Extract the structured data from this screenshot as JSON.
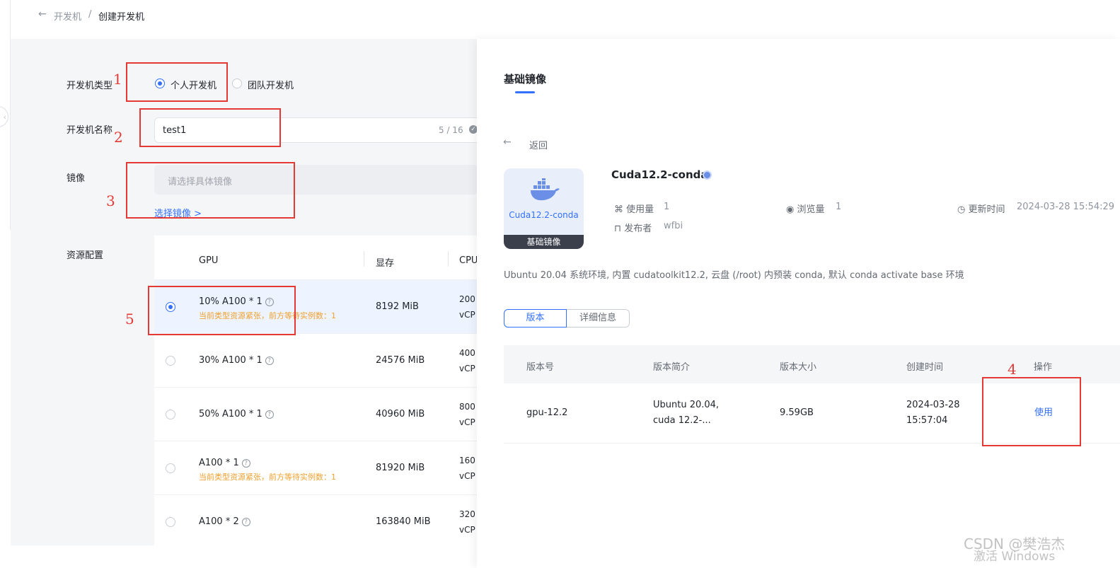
{
  "breadcrumb": {
    "back_icon": "←",
    "parent": "开发机",
    "separator": "/",
    "current": "创建开发机"
  },
  "form": {
    "type_label": "开发机类型",
    "type_options": [
      "个人开发机",
      "团队开发机"
    ],
    "type_selected": "个人开发机",
    "name_label": "开发机名称",
    "name_value": "test1",
    "name_count": "5 / 16",
    "image_label": "镜像",
    "image_placeholder": "请选择具体镜像",
    "image_link": "选择镜像 >",
    "resource_label": "资源配置"
  },
  "resource_table": {
    "headers": [
      "GPU",
      "显存",
      "CPU"
    ],
    "rows": [
      {
        "gpu": "10% A100 * 1",
        "warn": "当前类型资源紧张，前方等待实例数：1",
        "mem": "8192 MiB",
        "cpu1": "200",
        "cpu2": "vCP",
        "selected": true
      },
      {
        "gpu": "30% A100 * 1",
        "warn": "",
        "mem": "24576 MiB",
        "cpu1": "400",
        "cpu2": "vCP",
        "selected": false
      },
      {
        "gpu": "50% A100 * 1",
        "warn": "",
        "mem": "40960 MiB",
        "cpu1": "800",
        "cpu2": "vCP",
        "selected": false
      },
      {
        "gpu": "A100 * 1",
        "warn": "当前类型资源紧张，前方等待实例数：1",
        "mem": "81920 MiB",
        "cpu1": "160",
        "cpu2": "vCP",
        "selected": false
      },
      {
        "gpu": "A100 * 2",
        "warn": "",
        "mem": "163840 MiB",
        "cpu1": "320",
        "cpu2": "vCP",
        "selected": false
      }
    ]
  },
  "annotations": [
    "1",
    "2",
    "3",
    "4",
    "5"
  ],
  "panel": {
    "title": "基础镜像",
    "back_label": "返回",
    "image_name": "Cuda12.2-conda",
    "card_label": "Cuda12.2-conda",
    "card_footer": "基础镜像",
    "usage_label": "使用量",
    "usage_value": "1",
    "views_label": "浏览量",
    "views_value": "1",
    "updated_label": "更新时间",
    "updated_value": "2024-03-28 15:54:29",
    "publisher_label": "发布者",
    "publisher_value": "wfbi",
    "description": "Ubuntu 20.04 系统环境, 内置 cudatoolkit12.2, 云盘 (/root) 内预装 conda, 默认 conda activate base 环境",
    "tabs": [
      "版本",
      "详细信息"
    ],
    "active_tab": "版本",
    "version_headers": [
      "版本号",
      "版本简介",
      "版本大小",
      "创建时间",
      "操作"
    ],
    "version_row": {
      "version": "gpu-12.2",
      "intro_line1": "Ubuntu 20.04,",
      "intro_line2": "cuda 12.2-...",
      "size": "9.59GB",
      "created_line1": "2024-03-28",
      "created_line2": "15:57:04",
      "action": "使用"
    }
  },
  "watermark": {
    "line1": "CSDN @樊浩杰",
    "line2": "激活 Windows"
  },
  "colors": {
    "accent": "#3370ff",
    "annotation_red": "#e53935",
    "warning": "#f0a030"
  }
}
